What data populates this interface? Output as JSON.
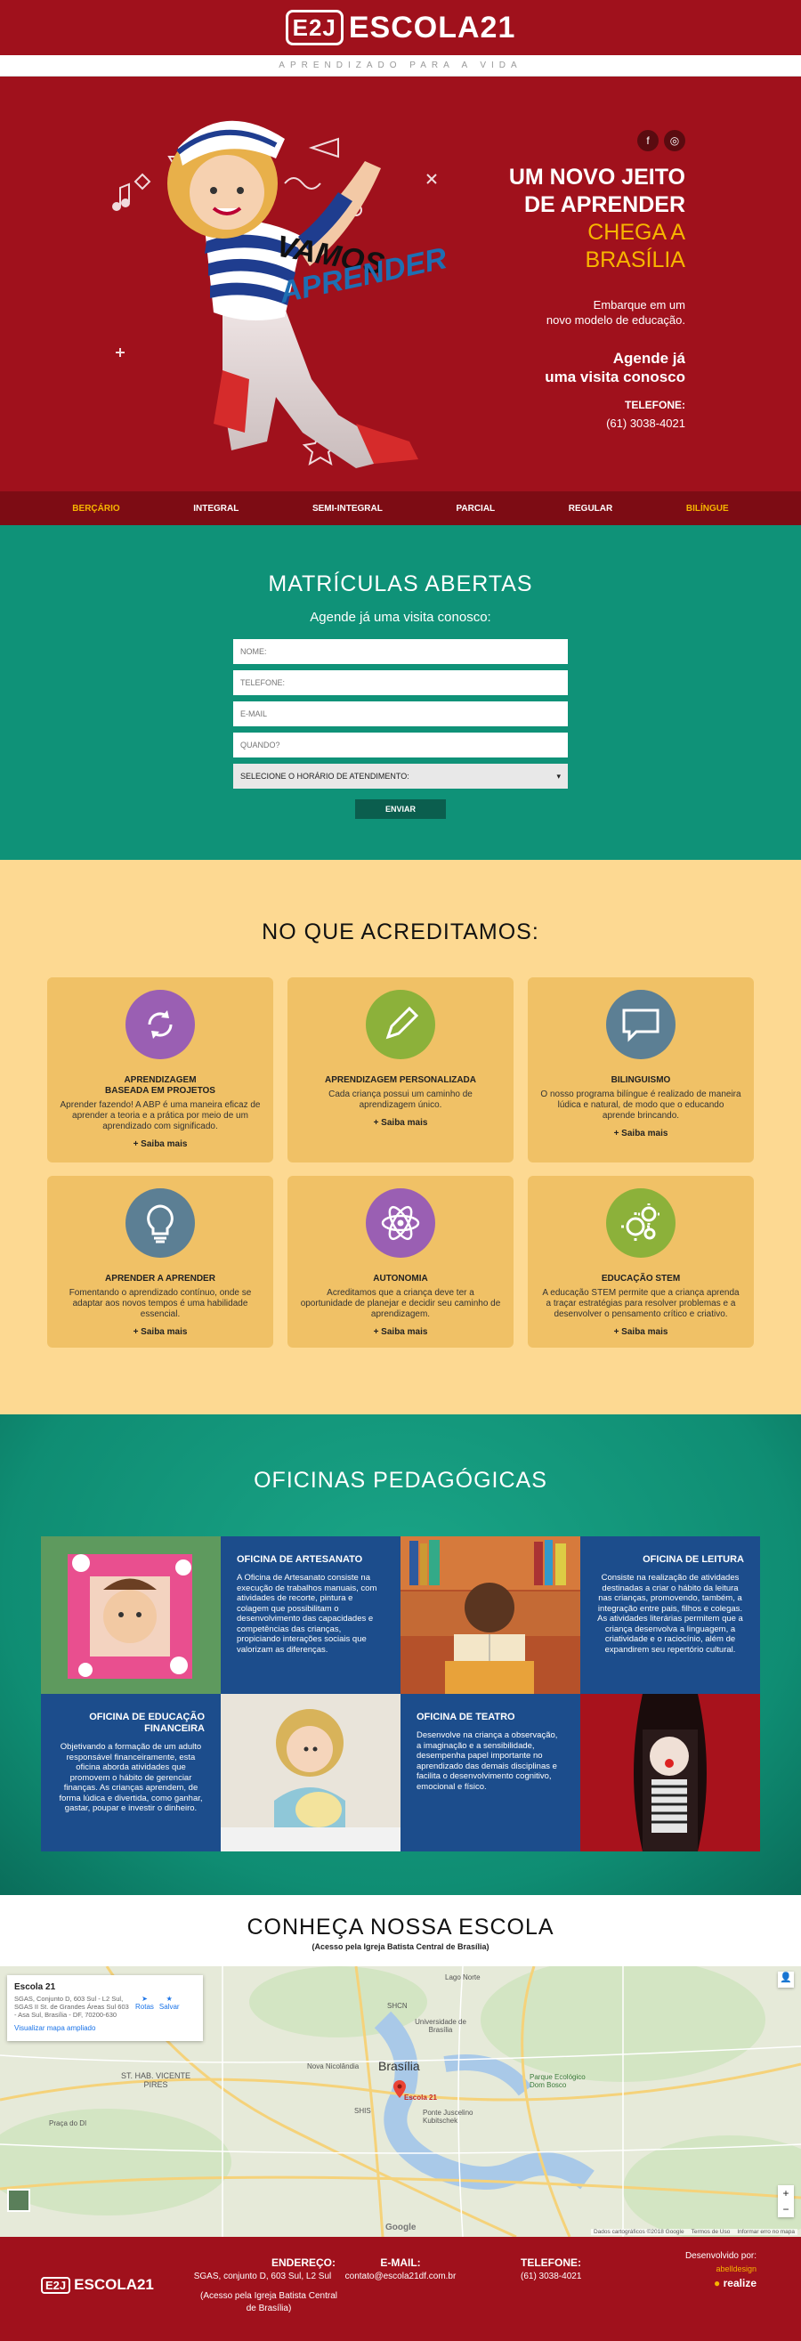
{
  "header": {
    "logo_mark": "E2J",
    "logo_text": "ESCOLA21",
    "tagline": "APRENDIZADO PARA A VIDA"
  },
  "hero": {
    "title_line1": "UM NOVO JEITO",
    "title_line2": "DE APRENDER",
    "yellow_line1": "CHEGA A",
    "yellow_line2": "BRASÍLIA",
    "sub_line1": "Embarque em um",
    "sub_line2": "novo modelo de educação.",
    "agende_line1": "Agende já",
    "agende_line2": "uma visita conosco",
    "tel_label": "TELEFONE:",
    "tel": "(61) 3038-4021",
    "slogan_line1": "VAMOS",
    "slogan_line2": "APRENDER",
    "social": [
      "facebook-icon",
      "instagram-icon"
    ]
  },
  "catnav": [
    {
      "label": "BERÇÁRIO",
      "highlight": true
    },
    {
      "label": "INTEGRAL",
      "highlight": false
    },
    {
      "label": "SEMI-INTEGRAL",
      "highlight": false
    },
    {
      "label": "PARCIAL",
      "highlight": false
    },
    {
      "label": "REGULAR",
      "highlight": false
    },
    {
      "label": "BILÍNGUE",
      "highlight": true
    }
  ],
  "matriculas": {
    "title": "MATRÍCULAS ABERTAS",
    "subtitle": "Agende já uma visita conosco:",
    "fields": {
      "nome": "NOME:",
      "telefone": "TELEFONE:",
      "email": "E-MAIL",
      "quando": "QUANDO?"
    },
    "select_value": "SELECIONE O HORÁRIO DE ATENDIMENTO:",
    "submit": "ENVIAR"
  },
  "acreditamos": {
    "title": "NO QUE ACREDITAMOS:",
    "more": "+ Saiba mais",
    "cards": [
      {
        "title_line1": "APRENDIZAGEM",
        "title_line2": "BASEADA EM PROJETOS",
        "text": "Aprender fazendo! A ABP é uma maneira eficaz de aprender a teoria e a prática por meio de um aprendizado com significado.",
        "icon": "cycle-icon",
        "color": "#9a5fb3"
      },
      {
        "title_line1": "APRENDIZAGEM PERSONALIZADA",
        "title_line2": "",
        "text": "Cada criança possui um caminho de aprendizagem único.",
        "icon": "pencil-icon",
        "color": "#8cb13a"
      },
      {
        "title_line1": "BILINGUISMO",
        "title_line2": "",
        "text": "O nosso programa bilíngue é realizado de maneira lúdica e natural, de modo que o educando aprende brincando.",
        "icon": "speech-bubble-icon",
        "color": "#5c7f94"
      },
      {
        "title_line1": "APRENDER A APRENDER",
        "title_line2": "",
        "text": "Fomentando o aprendizado contínuo, onde se adaptar aos novos tempos é uma habilidade essencial.",
        "icon": "lightbulb-icon",
        "color": "#5c7f94"
      },
      {
        "title_line1": "AUTONOMIA",
        "title_line2": "",
        "text": "Acreditamos que a criança deve ter a oportunidade de planejar e decidir seu caminho de aprendizagem.",
        "icon": "atom-icon",
        "color": "#9a5fb3"
      },
      {
        "title_line1": "EDUCAÇÃO STEM",
        "title_line2": "",
        "text": "A educação STEM permite que a criança aprenda a traçar estratégias para resolver problemas e a desenvolver o pensamento crítico e criativo.",
        "icon": "gears-icon",
        "color": "#8cb13a"
      }
    ]
  },
  "oficinas": {
    "title": "OFICINAS PEDAGÓGICAS",
    "items": [
      {
        "title": "OFICINA DE ARTESANATO",
        "text": "A Oficina de Artesanato consiste na execução de trabalhos manuais, com atividades de recorte, pintura e colagem que possibilitam o desenvolvimento das capacidades e competências das crianças, propiciando interações sociais que valorizam as diferenças."
      },
      {
        "title": "OFICINA DE LEITURA",
        "text": "Consiste na realização de atividades destinadas a criar o hábito da leitura nas crianças, promovendo, também, a integração entre pais, filhos e colegas. As atividades literárias permitem que a criança desenvolva a linguagem, a criatividade e o raciocínio, além de expandirem seu repertório cultural."
      },
      {
        "title_line1": "OFICINA DE EDUCAÇÃO",
        "title_line2": "FINANCEIRA",
        "text": "Objetivando a formação de um adulto responsável financeiramente, esta oficina aborda atividades que promovem o hábito de gerenciar finanças. As crianças aprendem, de forma lúdica e divertida, como ganhar, gastar, poupar e investir o dinheiro."
      },
      {
        "title": "OFICINA DE TEATRO",
        "text": "Desenvolve na criança a observação, a imaginação e a sensibilidade, desempenha papel importante no aprendizado das demais disciplinas e facilita o desenvolvimento cognitivo, emocional e físico."
      }
    ]
  },
  "conheca": {
    "title": "CONHEÇA NOSSA ESCOLA",
    "subtitle": "(Acesso pela Igreja Batista Central de Brasília)"
  },
  "map": {
    "card_title": "Escola 21",
    "card_address": "SGAS, Conjunto D, 603 Sul - L2 Sul, SGAS II St. de Grandes Áreas Sul 603 - Asa Sul, Brasília - DF, 70200-630",
    "rotas": "Rotas",
    "salvar": "Salvar",
    "ampliado": "Visualizar mapa ampliado",
    "pin_label": "Escola 21",
    "labels": [
      "Brasília",
      "Universidade de Brasília",
      "Nova Nicolândia",
      "ST. HAB. VICENTE PIRES",
      "Parque Ecológico Dom Bosco",
      "Ponte Juscelino Kubitschek",
      "Praça do DI",
      "SHCN",
      "SHIS",
      "Lago Norte"
    ],
    "attribution": "Dados cartográficos ©2018 Google",
    "terms": "Termos de Uso",
    "report": "Informar erro no mapa",
    "google": "Google"
  },
  "footer": {
    "logo_mark": "E2J",
    "logo_text": "ESCOLA21",
    "endereco_label": "ENDEREÇO:",
    "endereco": "SGAS, conjunto D, 603 Sul, L2 Sul",
    "endereco_note": "(Acesso pela Igreja Batista Central de Brasília)",
    "email_label": "E-MAIL:",
    "email": "contato@escola21df.com.br",
    "tel_label": "TELEFONE:",
    "tel": "(61) 3038-4021",
    "dev_label": "Desenvolvido por:",
    "dev1": "abelldesign",
    "dev2": "realize"
  }
}
